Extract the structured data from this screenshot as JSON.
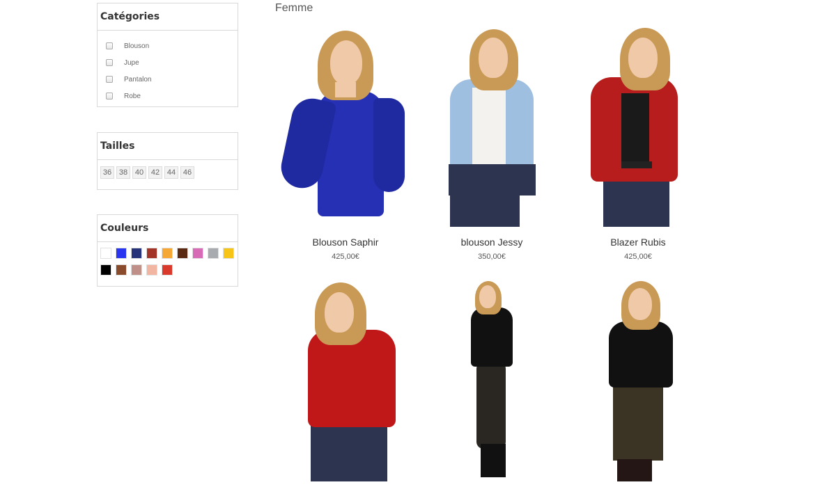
{
  "filters": {
    "categories": {
      "title": "Catégories",
      "items": [
        "Blouson",
        "Jupe",
        "Pantalon",
        "Robe"
      ]
    },
    "sizes": {
      "title": "Tailles",
      "items": [
        "36",
        "38",
        "40",
        "42",
        "44",
        "46"
      ]
    },
    "colors": {
      "title": "Couleurs",
      "swatches": [
        "#ffffff",
        "#2a35f0",
        "#27347a",
        "#a33428",
        "#f5a833",
        "#5a2a12",
        "#d76bb6",
        "#a8abaf",
        "#f7c518",
        "#000000",
        "#8a4a2c",
        "#be9087",
        "#f1b5a2",
        "#d93a2b"
      ]
    }
  },
  "section_title": "Femme",
  "products": [
    {
      "name": "Blouson Saphir",
      "price": "425,00€",
      "color": "#2630b5"
    },
    {
      "name": "blouson Jessy",
      "price": "350,00€",
      "color": "#9fbfe0"
    },
    {
      "name": "Blazer Rubis",
      "price": "425,00€",
      "color": "#b61d1c"
    },
    {
      "name": "",
      "price": "",
      "color": "#c01818"
    },
    {
      "name": "",
      "price": "",
      "color": "#111111"
    },
    {
      "name": "",
      "price": "",
      "color": "#111111"
    }
  ]
}
